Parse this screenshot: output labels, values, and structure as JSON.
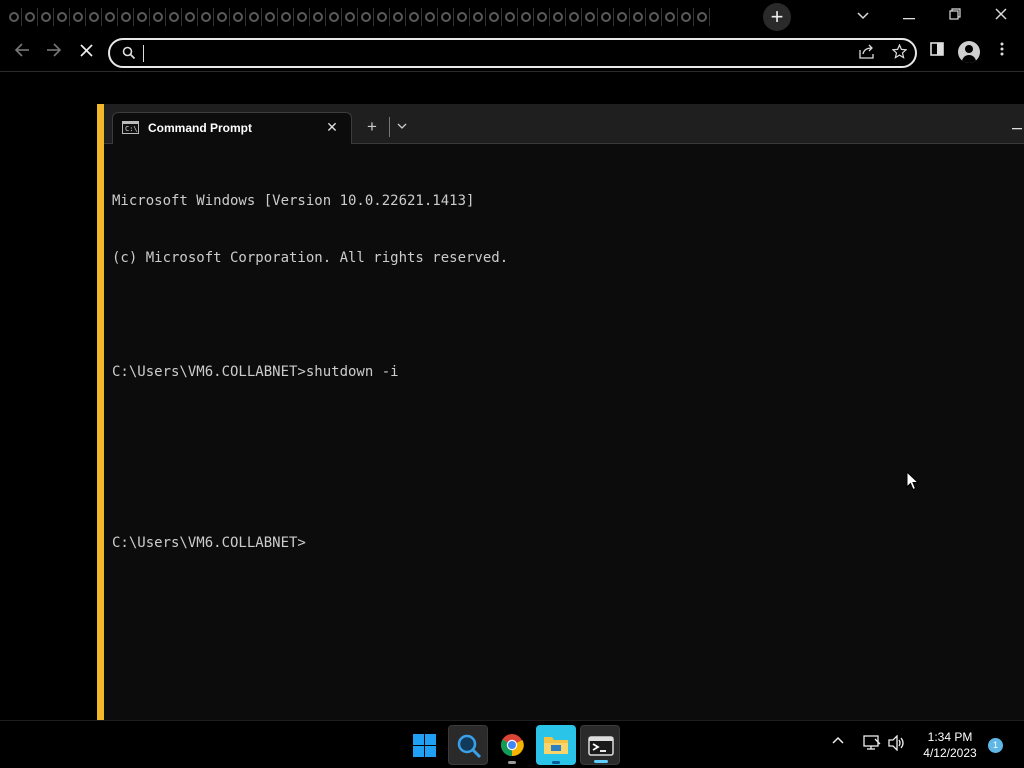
{
  "browser": {
    "tab_count": 44,
    "omnibox": {
      "value": "",
      "placeholder": ""
    },
    "window_controls": {
      "dropdown": "⌄",
      "minimize": "—",
      "restore": "❐",
      "close": "✕"
    },
    "nav": {
      "back": "←",
      "forward": "→",
      "stop": "✕"
    },
    "new_tab": "+"
  },
  "terminal": {
    "tab_title": "Command Prompt",
    "tab_close": "✕",
    "new_tab": "+",
    "dropdown": "⌄",
    "minimize": "—",
    "accent_color": "#f2b82a",
    "lines": [
      "Microsoft Windows [Version 10.0.22621.1413]",
      "(c) Microsoft Corporation. All rights reserved.",
      "",
      "C:\\Users\\VM6.COLLABNET>shutdown -i",
      "",
      "",
      "C:\\Users\\VM6.COLLABNET>"
    ]
  },
  "taskbar": {
    "apps": [
      "start-icon",
      "search-icon",
      "chrome-icon",
      "file-explorer-icon",
      "terminal-icon"
    ],
    "tray": {
      "chevron": "⌃"
    },
    "clock": {
      "time": "1:34 PM",
      "date": "4/12/2023"
    },
    "notification_count": "1"
  }
}
